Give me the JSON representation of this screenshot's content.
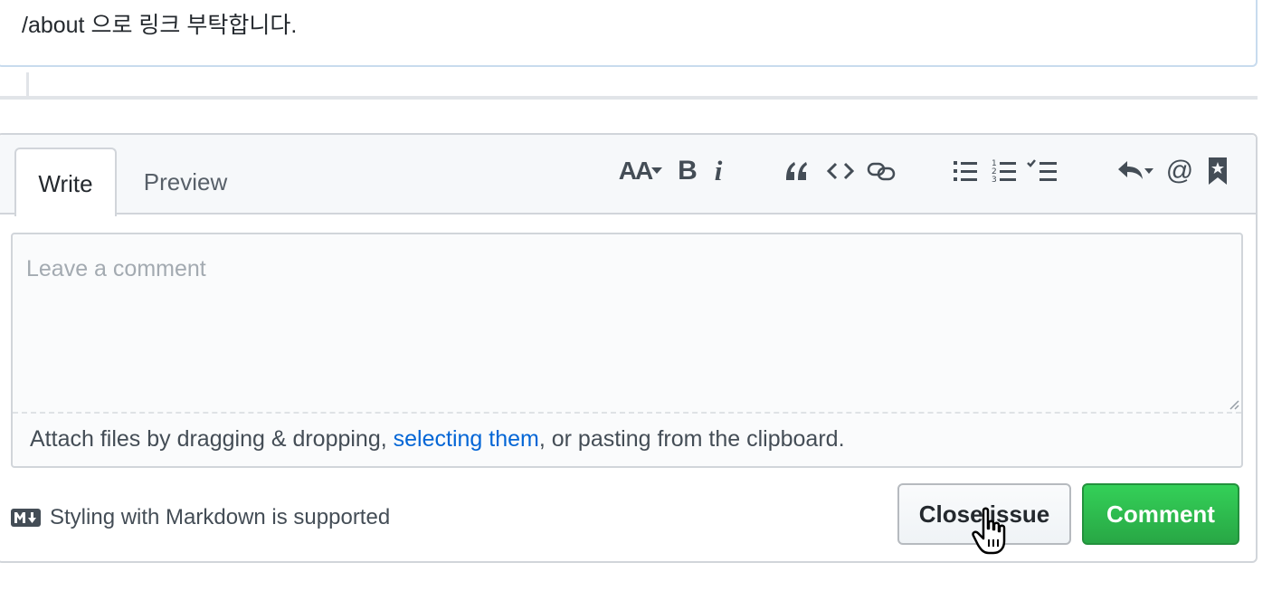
{
  "previous_comment": {
    "body": "/about 으로 링크 부탁합니다."
  },
  "editor": {
    "tabs": [
      {
        "label": "Write",
        "selected": true
      },
      {
        "label": "Preview",
        "selected": false
      }
    ],
    "toolbar": [
      {
        "name": "header-icon",
        "label": "AA"
      },
      {
        "name": "bold-icon",
        "label": "B"
      },
      {
        "name": "italic-icon",
        "label": "i"
      },
      {
        "name": "quote-icon"
      },
      {
        "name": "code-icon"
      },
      {
        "name": "link-icon"
      },
      {
        "name": "unordered-list-icon"
      },
      {
        "name": "ordered-list-icon"
      },
      {
        "name": "task-list-icon"
      },
      {
        "name": "reply-icon"
      },
      {
        "name": "mention-icon",
        "label": "@"
      },
      {
        "name": "saved-reply-icon"
      }
    ],
    "textarea": {
      "placeholder": "Leave a comment",
      "value": ""
    },
    "attach": {
      "before": "Attach files by dragging & dropping, ",
      "link": "selecting them",
      "after": ", or pasting from the clipboard."
    }
  },
  "footer": {
    "markdown_hint": "Styling with Markdown is supported",
    "close_button": "Close issue",
    "comment_button": "Comment"
  },
  "colors": {
    "accent_link": "#0366d6",
    "comment_button": "#28a745",
    "border": "#d1d5da"
  }
}
